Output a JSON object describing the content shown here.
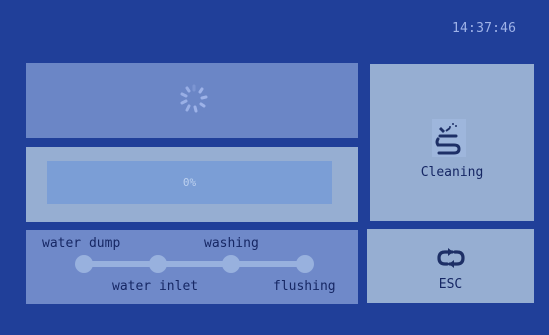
{
  "header": {
    "time": "14:37:46"
  },
  "progress": {
    "text": "0%",
    "value": 0
  },
  "steps": {
    "labels": [
      "water dump",
      "washing",
      "water inlet",
      "flushing"
    ]
  },
  "actions": {
    "cleaning_label": "Cleaning",
    "esc_label": "ESC"
  },
  "icons": [
    "spinner-icon",
    "cleaning-icon",
    "cycle-icon"
  ]
}
